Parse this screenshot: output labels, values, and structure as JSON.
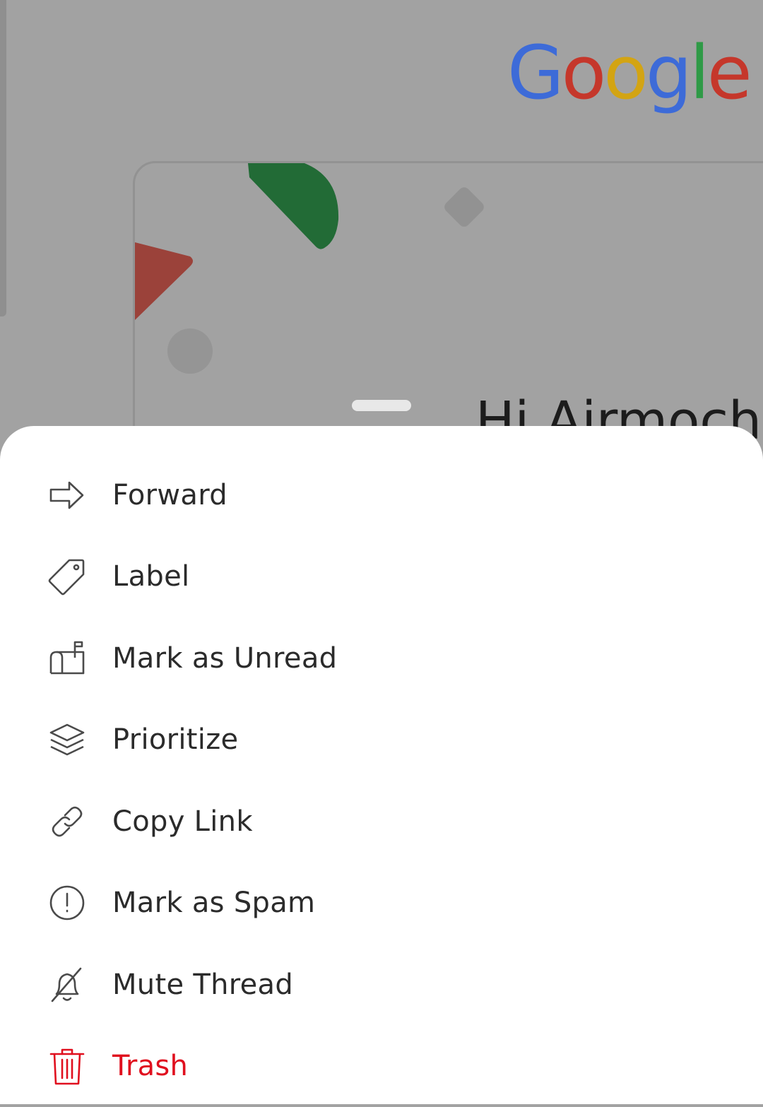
{
  "background": {
    "logo_letters": [
      {
        "char": "G",
        "color": "#3d6bd8"
      },
      {
        "char": "o",
        "color": "#d13c2f"
      },
      {
        "char": "o",
        "color": "#e8b418"
      },
      {
        "char": "g",
        "color": "#3d6bd8"
      },
      {
        "char": "l",
        "color": "#2f9a47"
      },
      {
        "char": "e",
        "color": "#d13c2f"
      }
    ],
    "greeting": "Hi Airmoch"
  },
  "menu": {
    "items": [
      {
        "label": "Forward",
        "icon": "forward-icon"
      },
      {
        "label": "Label",
        "icon": "label-tag-icon"
      },
      {
        "label": "Mark as Unread",
        "icon": "mailbox-icon"
      },
      {
        "label": "Prioritize",
        "icon": "layers-icon"
      },
      {
        "label": "Copy Link",
        "icon": "link-icon"
      },
      {
        "label": "Mark as Spam",
        "icon": "alert-circle-icon"
      },
      {
        "label": "Mute Thread",
        "icon": "bell-off-icon"
      },
      {
        "label": "Trash",
        "icon": "trash-icon"
      }
    ],
    "danger_color": "#e00f1e",
    "text_color": "#2b2b2b"
  }
}
